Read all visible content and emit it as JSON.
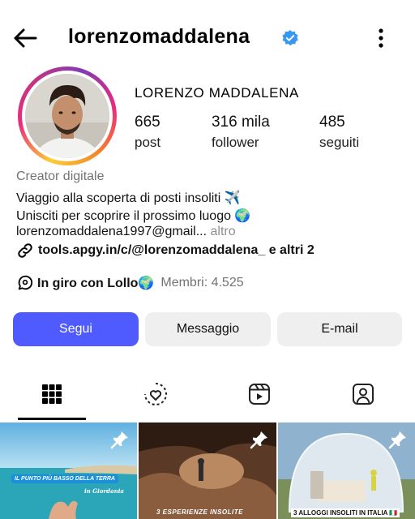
{
  "header": {
    "username": "lorenzomaddalena",
    "icons": {
      "back": "arrow-left-icon",
      "verified": "verified-badge-icon",
      "more": "more-vertical-icon"
    }
  },
  "profile": {
    "full_name": "LORENZO MADDALENA",
    "stats": [
      {
        "value": "665",
        "label": "post"
      },
      {
        "value": "316 mila",
        "label": "follower"
      },
      {
        "value": "485",
        "label": "seguiti"
      }
    ],
    "category": "Creator digitale",
    "bio_lines": [
      "Viaggio alla scoperta di posti insoliti ✈️",
      "Unisciti per scoprire il prossimo luogo 🌍"
    ],
    "email_line": "lorenzomaddalena1997@gmail...",
    "more_label": "altro",
    "link_text": "tools.apgy.in/c/@lorenzomaddalena_ e altri 2",
    "group_name": "In giro con Lollo🌍",
    "group_members": "Membri: 4.525"
  },
  "actions": {
    "follow": "Segui",
    "message": "Messaggio",
    "email": "E-mail"
  },
  "tabs": [
    {
      "name": "grid-icon",
      "active": true
    },
    {
      "name": "reels-icon",
      "active": false
    },
    {
      "name": "video-icon",
      "active": false
    },
    {
      "name": "tagged-icon",
      "active": false
    }
  ],
  "posts": [
    {
      "caption": "IL PUNTO PIÙ BASSO DELLA TERRA",
      "subcaption": "in Giordania",
      "pinned": true
    },
    {
      "caption": "3 ESPERIENZE INSOLITE",
      "pinned": true
    },
    {
      "caption": "3 ALLOGGI INSOLITI IN ITALIA 🇮🇹",
      "pinned": true
    }
  ],
  "colors": {
    "follow_button": "#4f5bff",
    "secondary_button": "#efefef",
    "verified": "#3897f0",
    "muted_text": "#737373"
  }
}
